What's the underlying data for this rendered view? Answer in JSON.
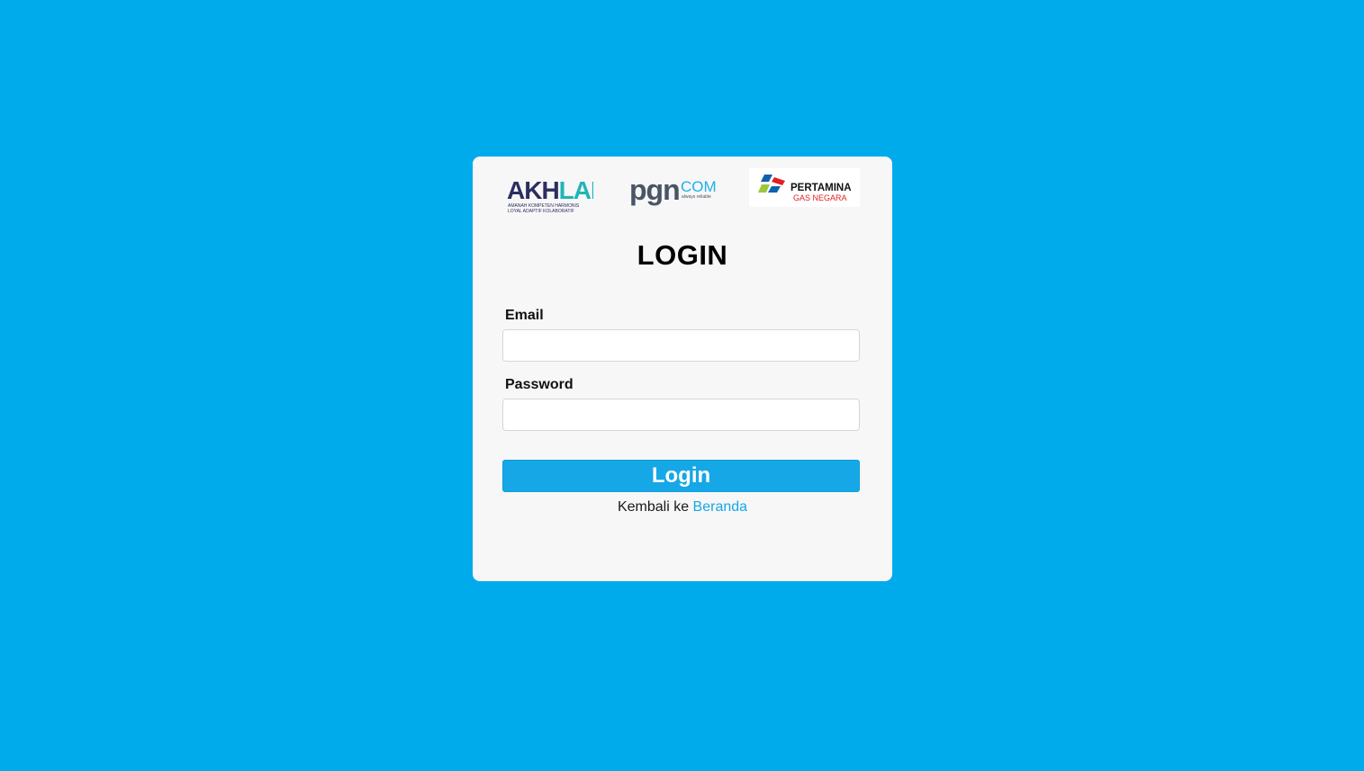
{
  "page": {
    "background_color": "#00abeb",
    "title": "LOGIN"
  },
  "logos": {
    "akhlak": {
      "icon": "akhlak-logo",
      "text_dark": "AKH",
      "text_teal": "LAK",
      "tagline_1": "AMANAH KOMPETEN HARMONIS",
      "tagline_2": "LOYAL ADAPTIF KOLABORATIF"
    },
    "pgn": {
      "icon": "pgn-com-logo",
      "text_main": "pgn",
      "text_suffix": "COM",
      "tagline": "always reliable"
    },
    "pertamina": {
      "icon": "pertamina-gas-negara-logo",
      "text_main": "PERTAMINA",
      "text_sub": "GAS NEGARA"
    }
  },
  "form": {
    "email_label": "Email",
    "email_value": "",
    "email_placeholder": "",
    "password_label": "Password",
    "password_value": "",
    "password_placeholder": "",
    "submit_label": "Login"
  },
  "footer": {
    "back_text": "Kembali ke",
    "back_link_label": "Beranda"
  },
  "colors": {
    "accent": "#16a7e7",
    "card": "#f7f7f7",
    "akhlak_dark": "#2b2e5f",
    "akhlak_teal": "#1fb5b8",
    "pgn_gray": "#4a5566",
    "pgn_cyan": "#1fb1e6",
    "pertamina_red": "#e31e24",
    "pertamina_blue": "#0d62ad",
    "pertamina_green": "#9bc93b"
  }
}
